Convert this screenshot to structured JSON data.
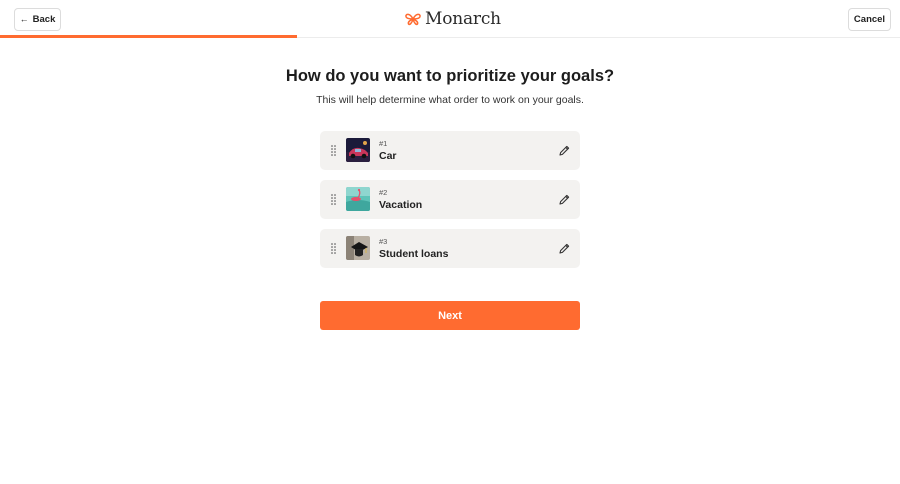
{
  "header": {
    "back_label": "Back",
    "cancel_label": "Cancel",
    "brand": "Monarch",
    "progress_percent": 33
  },
  "main": {
    "title": "How do you want to prioritize your goals?",
    "subtitle": "This will help determine what order to work on your goals."
  },
  "goals": [
    {
      "rank": "#1",
      "name": "Car",
      "image_icon": "car-photo"
    },
    {
      "rank": "#2",
      "name": "Vacation",
      "image_icon": "beach-photo"
    },
    {
      "rank": "#3",
      "name": "Student loans",
      "image_icon": "graduation-cap-photo"
    }
  ],
  "actions": {
    "next_label": "Next"
  },
  "colors": {
    "accent": "#ff6b30",
    "card_bg": "#f3f2f0",
    "border": "#dcdcdc"
  }
}
